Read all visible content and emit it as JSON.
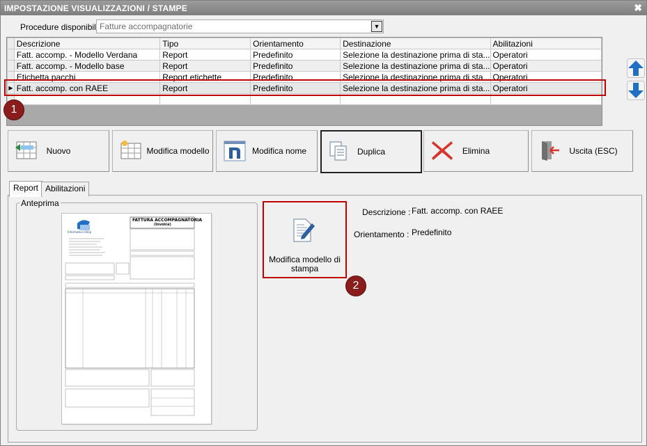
{
  "window": {
    "title": "IMPOSTAZIONE VISUALIZZAZIONI / STAMPE",
    "close_glyph": "✖"
  },
  "procedures": {
    "label": "Procedure disponibili :",
    "value": "Fatture accompagnatorie"
  },
  "grid": {
    "columns": [
      "Descrizione",
      "Tipo",
      "Orientamento",
      "Destinazione",
      "Abilitazioni"
    ],
    "rows": [
      {
        "descrizione": "Fatt. accomp. - Modello Verdana",
        "tipo": "Report",
        "orientamento": "Predefinito",
        "destinazione": "Selezione la destinazione prima di sta...",
        "abilitazioni": "Operatori"
      },
      {
        "descrizione": "Fatt. accomp. - Modello base",
        "tipo": "Report",
        "orientamento": "Predefinito",
        "destinazione": "Selezione la destinazione prima di sta...",
        "abilitazioni": "Operatori"
      },
      {
        "descrizione": "Etichetta pacchi",
        "tipo": "Report etichette",
        "orientamento": "Predefinito",
        "destinazione": "Selezione la destinazione prima di sta...",
        "abilitazioni": "Operatori"
      },
      {
        "descrizione": "Fatt. accomp. con RAEE",
        "tipo": "Report",
        "orientamento": "Predefinito",
        "destinazione": "Selezione la destinazione prima di sta...",
        "abilitazioni": "Operatori"
      }
    ]
  },
  "badges": {
    "one": "1",
    "two": "2"
  },
  "toolbar": {
    "nuovo": "Nuovo",
    "modifica_modello": "Modifica modello",
    "modifica_nome": "Modifica nome",
    "duplica": "Duplica",
    "elimina": "Elimina",
    "uscita": "Uscita (ESC)"
  },
  "tabs": {
    "report": "Report",
    "abilitazioni": "Abilitazioni"
  },
  "preview": {
    "group_title": "Anteprima",
    "doc_title": "FATTURA ACCOMPAGNATORIA",
    "doc_subtitle": "(Invoice)",
    "company": "Informatica Shop"
  },
  "edit_template_button": {
    "label": "Modifica modello di stampa"
  },
  "details": {
    "descrizione_label": "Descrizione :",
    "descrizione_value": "Fatt. accomp. con RAEE",
    "orientamento_label": "Orientamento :",
    "orientamento_value": "Predefinito"
  },
  "colors": {
    "accent_red": "#c00000",
    "badge": "#8a1c1c",
    "arrow_blue": "#1f6fc4"
  }
}
